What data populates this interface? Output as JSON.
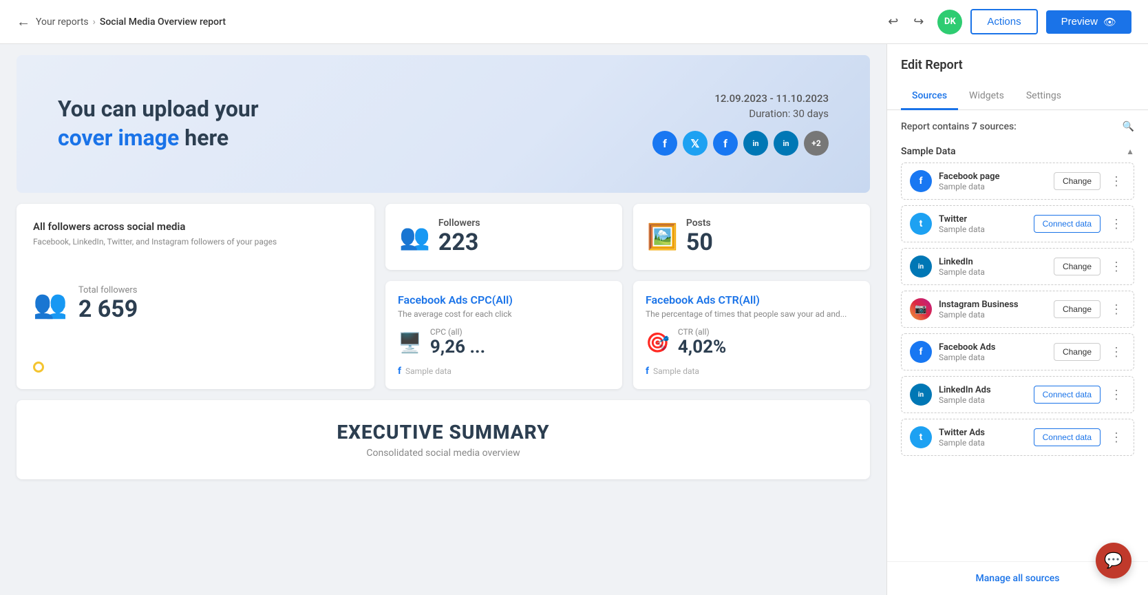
{
  "header": {
    "back_label": "←",
    "breadcrumb_link": "Your reports",
    "breadcrumb_sep": "›",
    "breadcrumb_current": "Social Media Overview report",
    "undo_icon": "↩",
    "redo_icon": "↪",
    "avatar_initials": "DK",
    "actions_label": "Actions",
    "preview_label": "Preview",
    "preview_icon": "👁"
  },
  "cover": {
    "line1": "You can upload your",
    "line2_blue": "cover image",
    "line2_rest": " here",
    "date": "12.09.2023 - 11.10.2023",
    "duration": "Duration: 30 days",
    "social_icons": [
      {
        "label": "f",
        "class": "si-fb"
      },
      {
        "label": "t",
        "class": "si-tw"
      },
      {
        "label": "f",
        "class": "si-fb2"
      },
      {
        "label": "in",
        "class": "si-li"
      },
      {
        "label": "in",
        "class": "si-li2"
      },
      {
        "label": "+2",
        "class": "si-more"
      }
    ]
  },
  "stats": {
    "all_followers_title": "All followers across social media",
    "all_followers_sub": "Facebook, LinkedIn, Twitter, and Instagram followers of your pages",
    "total_followers_label": "Total followers",
    "total_followers_value": "2 659",
    "followers_label": "Followers",
    "followers_value": "223",
    "posts_label": "Posts",
    "posts_value": "50",
    "cpc_title": "Facebook Ads CPC(All)",
    "cpc_desc": "The average cost for each click",
    "cpc_sub_label": "CPC (all)",
    "cpc_value": "9,26 ...",
    "cpc_footer": "Sample data",
    "ctr_title": "Facebook Ads CTR(All)",
    "ctr_desc": "The percentage of times that people saw your ad and...",
    "ctr_sub_label": "CTR (all)",
    "ctr_value": "4,02%",
    "ctr_footer": "Sample data"
  },
  "executive_summary": {
    "title": "EXECUTIVE SUMMARY",
    "sub": "Consolidated social media overview"
  },
  "right_panel": {
    "title": "Edit Report",
    "tabs": [
      {
        "label": "Sources",
        "active": true
      },
      {
        "label": "Widgets",
        "active": false
      },
      {
        "label": "Settings",
        "active": false
      }
    ],
    "sources_count_text": "Report contains",
    "sources_count": "7",
    "sources_count_suffix": "sources:",
    "group_label": "Sample Data",
    "sources": [
      {
        "name": "Facebook page",
        "sub": "Sample data",
        "btn": "Change",
        "btn_type": "change",
        "icon_class": "si-fb",
        "icon_label": "f"
      },
      {
        "name": "Twitter",
        "sub": "Sample data",
        "btn": "Connect data",
        "btn_type": "connect",
        "icon_class": "si-tw",
        "icon_label": "t"
      },
      {
        "name": "LinkedIn",
        "sub": "Sample data",
        "btn": "Change",
        "btn_type": "change",
        "icon_class": "si-li",
        "icon_label": "in"
      },
      {
        "name": "Instagram Business",
        "sub": "Sample data",
        "btn": "Change",
        "btn_type": "change",
        "icon_class": "si-ig",
        "icon_label": "ig"
      },
      {
        "name": "Facebook Ads",
        "sub": "Sample data",
        "btn": "Change",
        "btn_type": "change",
        "icon_class": "si-fb",
        "icon_label": "f"
      },
      {
        "name": "LinkedIn Ads",
        "sub": "Sample data",
        "btn": "Connect data",
        "btn_type": "connect",
        "icon_class": "si-li",
        "icon_label": "in"
      },
      {
        "name": "Twitter Ads",
        "sub": "Sample data",
        "btn": "Connect data",
        "btn_type": "connect",
        "icon_class": "si-tw",
        "icon_label": "t"
      }
    ],
    "manage_sources": "Manage all sources"
  }
}
